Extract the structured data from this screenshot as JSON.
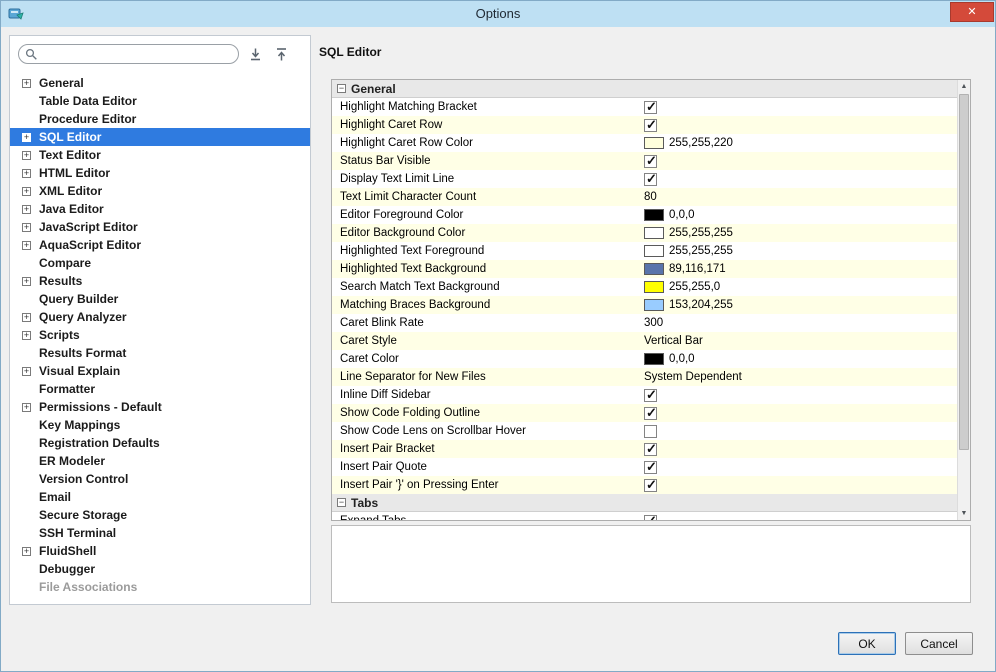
{
  "window": {
    "title": "Options",
    "close_glyph": "✕"
  },
  "sidebar": {
    "search": {
      "placeholder": "",
      "value": ""
    },
    "tree": [
      {
        "label": "General",
        "expandable": true
      },
      {
        "label": "Table Data Editor"
      },
      {
        "label": "Procedure Editor"
      },
      {
        "label": "SQL Editor",
        "expandable": true,
        "selected": true
      },
      {
        "label": "Text Editor",
        "expandable": true
      },
      {
        "label": "HTML Editor",
        "expandable": true
      },
      {
        "label": "XML Editor",
        "expandable": true
      },
      {
        "label": "Java Editor",
        "expandable": true
      },
      {
        "label": "JavaScript Editor",
        "expandable": true
      },
      {
        "label": "AquaScript Editor",
        "expandable": true
      },
      {
        "label": "Compare"
      },
      {
        "label": "Results",
        "expandable": true
      },
      {
        "label": "Query Builder"
      },
      {
        "label": "Query Analyzer",
        "expandable": true
      },
      {
        "label": "Scripts",
        "expandable": true
      },
      {
        "label": "Results Format"
      },
      {
        "label": "Visual Explain",
        "expandable": true
      },
      {
        "label": "Formatter"
      },
      {
        "label": "Permissions - Default",
        "expandable": true
      },
      {
        "label": "Key Mappings"
      },
      {
        "label": "Registration Defaults"
      },
      {
        "label": "ER Modeler"
      },
      {
        "label": "Version Control"
      },
      {
        "label": "Email"
      },
      {
        "label": "Secure Storage"
      },
      {
        "label": "SSH Terminal"
      },
      {
        "label": "FluidShell",
        "expandable": true
      },
      {
        "label": "Debugger"
      },
      {
        "label": "File Associations",
        "disabled": true
      }
    ]
  },
  "main": {
    "title": "SQL Editor",
    "groups": [
      {
        "label": "General",
        "rows": [
          {
            "name": "Highlight Matching Bracket",
            "type": "checkbox",
            "checked": true
          },
          {
            "name": "Highlight Caret Row",
            "type": "checkbox",
            "checked": true
          },
          {
            "name": "Highlight Caret Row Color",
            "type": "color",
            "swatch": "#FFFFDC",
            "value": "255,255,220"
          },
          {
            "name": "Status Bar Visible",
            "type": "checkbox",
            "checked": true
          },
          {
            "name": "Display Text Limit Line",
            "type": "checkbox",
            "checked": true
          },
          {
            "name": "Text Limit Character Count",
            "type": "text",
            "value": "80"
          },
          {
            "name": "Editor Foreground Color",
            "type": "color",
            "swatch": "#000000",
            "value": "0,0,0"
          },
          {
            "name": "Editor Background Color",
            "type": "color",
            "swatch": "#FFFFFF",
            "value": "255,255,255"
          },
          {
            "name": "Highlighted Text Foreground",
            "type": "color",
            "swatch": "#FFFFFF",
            "value": "255,255,255"
          },
          {
            "name": "Highlighted Text Background",
            "type": "color",
            "swatch": "#5974AB",
            "value": "89,116,171"
          },
          {
            "name": "Search Match Text Background",
            "type": "color",
            "swatch": "#FFFF00",
            "value": "255,255,0"
          },
          {
            "name": "Matching Braces Background",
            "type": "color",
            "swatch": "#99CCFF",
            "value": "153,204,255"
          },
          {
            "name": "Caret Blink Rate",
            "type": "text",
            "value": "300"
          },
          {
            "name": "Caret Style",
            "type": "text",
            "value": "Vertical Bar"
          },
          {
            "name": "Caret Color",
            "type": "color",
            "swatch": "#000000",
            "value": "0,0,0"
          },
          {
            "name": "Line Separator for New Files",
            "type": "text",
            "value": "System Dependent"
          },
          {
            "name": "Inline Diff Sidebar",
            "type": "checkbox",
            "checked": true
          },
          {
            "name": "Show Code Folding Outline",
            "type": "checkbox",
            "checked": true
          },
          {
            "name": "Show Code Lens on Scrollbar Hover",
            "type": "checkbox",
            "checked": false
          },
          {
            "name": "Insert Pair Bracket",
            "type": "checkbox",
            "checked": true
          },
          {
            "name": "Insert Pair Quote",
            "type": "checkbox",
            "checked": true
          },
          {
            "name": "Insert Pair '}' on Pressing Enter",
            "type": "checkbox",
            "checked": true
          }
        ]
      },
      {
        "label": "Tabs",
        "rows": [
          {
            "name": "Expand Tabs",
            "type": "checkbox",
            "checked": true
          }
        ]
      }
    ]
  },
  "footer": {
    "ok_label": "OK",
    "cancel_label": "Cancel"
  },
  "colors": {
    "titlebar": "#bee0f3",
    "close_button": "#d44a3a",
    "selection": "#2f7be0",
    "row_stripe": "#ffffe6",
    "group_header_bg": "#e8e8e8"
  },
  "icons": {
    "checkmark": "✓",
    "expander_collapsed": "+",
    "expander_expanded": "−",
    "scroll_up": "▲",
    "scroll_down": "▼"
  }
}
